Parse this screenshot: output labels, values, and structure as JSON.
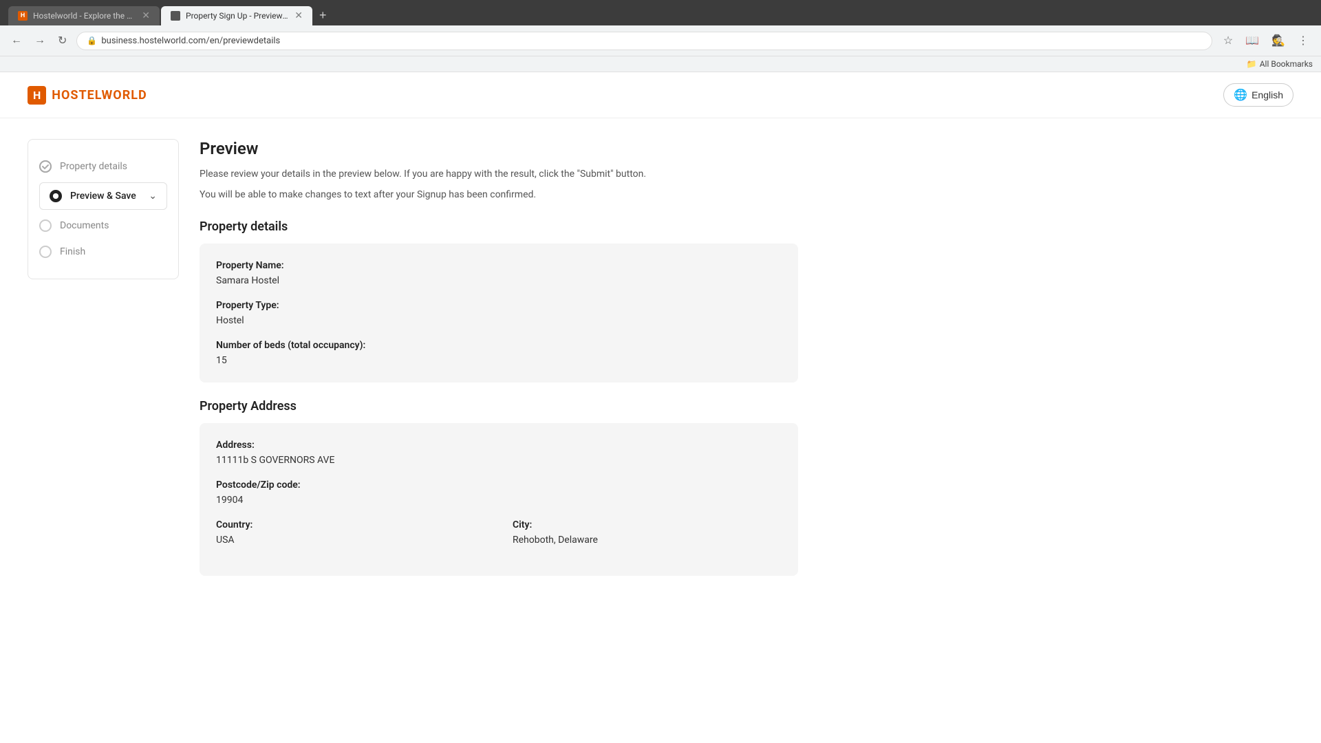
{
  "browser": {
    "tabs": [
      {
        "id": "tab1",
        "title": "Hostelworld - Explore the worl",
        "favicon": "HW",
        "active": false
      },
      {
        "id": "tab2",
        "title": "Property Sign Up - Preview an...",
        "favicon": "PS",
        "active": true
      }
    ],
    "url": "business.hostelworld.com/en/previewdetails",
    "bookmarks_label": "All Bookmarks"
  },
  "header": {
    "logo_text": "HOSTELWORLD",
    "lang_button": "English"
  },
  "sidebar": {
    "steps": [
      {
        "id": "step1",
        "label": "Property details",
        "state": "completed"
      },
      {
        "id": "step2",
        "label": "Preview & Save",
        "state": "active"
      },
      {
        "id": "step3",
        "label": "Documents",
        "state": "inactive"
      },
      {
        "id": "step4",
        "label": "Finish",
        "state": "inactive"
      }
    ]
  },
  "main": {
    "preview_title": "Preview",
    "preview_desc_line1": "Please review your details in the preview below. If you are happy with the result, click the \"Submit\" button.",
    "preview_desc_line2": "You will be able to make changes to text after your Signup has been confirmed.",
    "property_details_section": "Property details",
    "property_details_card": {
      "fields": [
        {
          "label": "Property Name:",
          "value": "Samara Hostel"
        },
        {
          "label": "Property Type:",
          "value": "Hostel"
        },
        {
          "label": "Number of beds (total occupancy):",
          "value": "15"
        }
      ]
    },
    "property_address_section": "Property Address",
    "property_address_card": {
      "fields": [
        {
          "label": "Address:",
          "value": "11111b S GOVERNORS AVE"
        },
        {
          "label": "Postcode/Zip code:",
          "value": "19904"
        }
      ],
      "row_fields": [
        {
          "label": "Country:",
          "value": "USA"
        },
        {
          "label": "City:",
          "value": "Rehoboth, Delaware"
        }
      ]
    }
  }
}
